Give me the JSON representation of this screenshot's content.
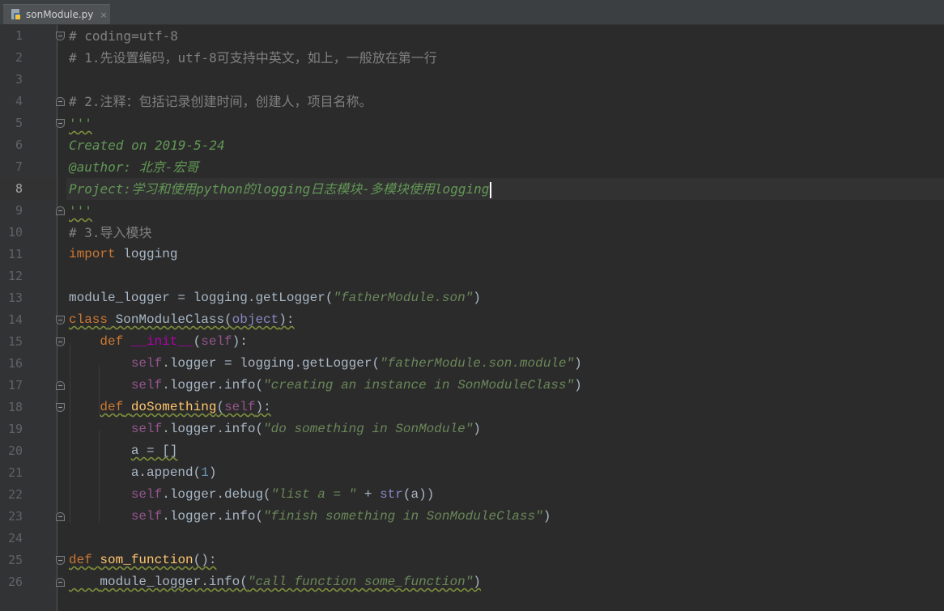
{
  "tab": {
    "file_name": "sonModule.py",
    "close": "×",
    "icon": "python-file-icon"
  },
  "line_numbers": [
    "1",
    "2",
    "3",
    "4",
    "5",
    "6",
    "7",
    "8",
    "9",
    "10",
    "11",
    "12",
    "13",
    "14",
    "15",
    "16",
    "17",
    "18",
    "19",
    "20",
    "21",
    "22",
    "23",
    "24",
    "25",
    "26"
  ],
  "current_line": "8",
  "code": {
    "l1": "# coding=utf-8",
    "l2": "# 1.先设置编码，utf-8可支持中英文，如上，一般放在第一行",
    "l4": "# 2.注释：包括记录创建时间，创建人，项目名称。",
    "l5": "'''",
    "l6": "Created on 2019-5-24",
    "l7": "@author: 北京-宏哥",
    "l8": "Project:学习和使用python的logging日志模块-多模块使用logging",
    "l9": "'''",
    "l10": "# 3.导入模块",
    "l11_kw": "import",
    "l11_rest": " logging",
    "l13_a": "module_logger = logging.getLogger(",
    "l13_s": "\"fatherModule.son\"",
    "l13_b": ")",
    "l14_kw": "class",
    "l14_name": " SonModuleClass(",
    "l14_obj": "object",
    "l14_end": "):",
    "l15_kw": "def",
    "l15_fn": "__init__",
    "l15_self": "self",
    "l16_self": "self",
    "l16_a": ".logger = logging.getLogger(",
    "l16_s": "\"fatherModule.son.module\"",
    "l16_b": ")",
    "l17_self": "self",
    "l17_a": ".logger.info(",
    "l17_s": "\"creating an instance in SonModuleClass\"",
    "l17_b": ")",
    "l18_kw": "def",
    "l18_fn": "doSomething",
    "l18_self": "self",
    "l19_self": "self",
    "l19_a": ".logger.info(",
    "l19_s": "\"do something in SonModule\"",
    "l19_b": ")",
    "l20": "a = []",
    "l21_a": "a.append(",
    "l21_n": "1",
    "l21_b": ")",
    "l22_self": "self",
    "l22_a": ".logger.debug(",
    "l22_s": "\"list a = \"",
    "l22_b": " + ",
    "l22_str": "str",
    "l22_c": "(a))",
    "l23_self": "self",
    "l23_a": ".logger.info(",
    "l23_s": "\"finish something in SonModuleClass\"",
    "l23_b": ")",
    "l25_kw": "def",
    "l25_fn": "som_function",
    "l25_end": "():",
    "l26_a": "module_logger.info(",
    "l26_s": "\"call function some_function\"",
    "l26_b": ")"
  },
  "colors": {
    "background": "#2b2b2b",
    "gutter": "#313335",
    "keyword": "#cc7832",
    "string": "#6a8759",
    "comment": "#808080",
    "docstring": "#629755",
    "self": "#94558d",
    "number": "#6897bb"
  }
}
